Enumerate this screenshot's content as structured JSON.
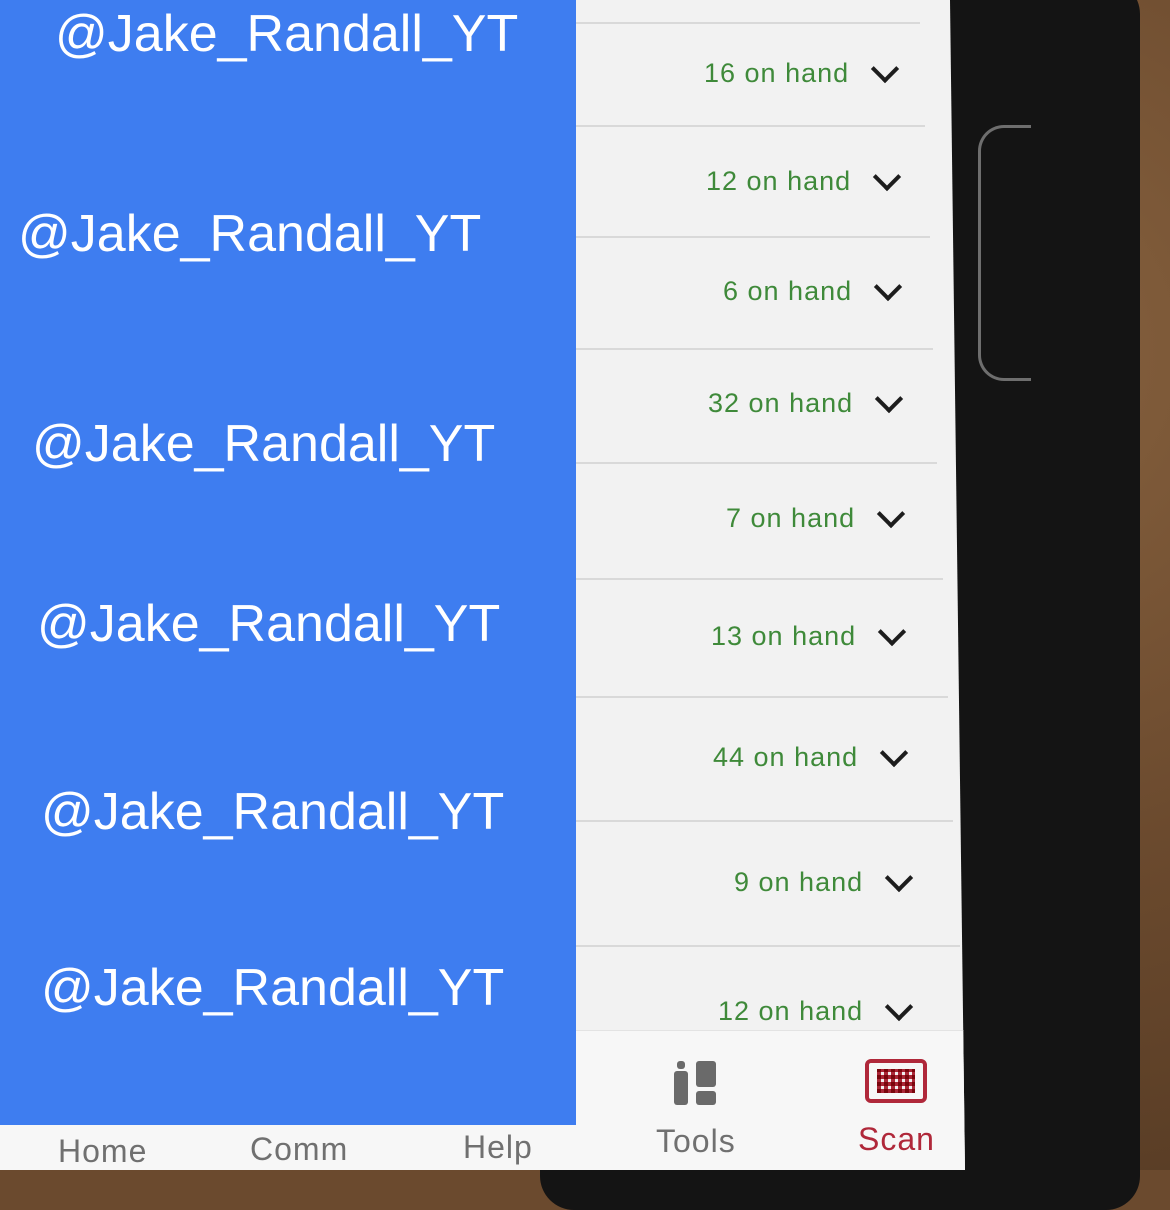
{
  "watermark": "@Jake_Randall_YT",
  "inventory": [
    {
      "stock": "16 on hand"
    },
    {
      "stock": "12 on hand"
    },
    {
      "stock": "6 on hand"
    },
    {
      "stock": "32 on hand"
    },
    {
      "stock": "7 on hand"
    },
    {
      "stock": "13 on hand"
    },
    {
      "stock": "44 on hand"
    },
    {
      "stock": "9 on hand"
    },
    {
      "stock": "12 on hand"
    }
  ],
  "tabbar": {
    "home": "Home",
    "comm": "Comm",
    "help": "Help",
    "tools": "Tools",
    "scan": "Scan",
    "active": "Scan"
  },
  "colors": {
    "stock_text": "#3f8a3a",
    "active_tab": "#b0283a",
    "overlay": "#3e7df0"
  },
  "icons": {
    "expand": "chevron-down-icon",
    "tools": "tools-icon",
    "scan": "barcode-scan-icon"
  }
}
